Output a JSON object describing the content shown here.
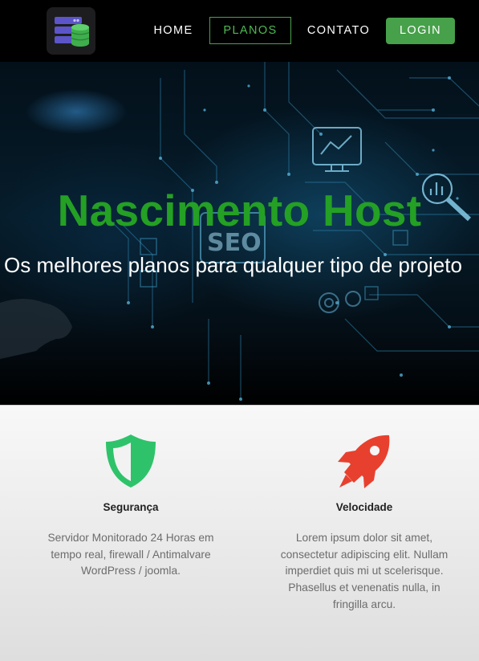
{
  "nav": {
    "logo_icon": "server-database-icon",
    "home": "HOME",
    "planos": "PLANOS",
    "contato": "CONTATO",
    "login": "LOGIN"
  },
  "hero": {
    "title": "Nascimento Host",
    "subtitle": "Os melhores planos para qualquer tipo de projeto",
    "background_labels": [
      "SEO"
    ]
  },
  "features": [
    {
      "icon": "shield-icon",
      "icon_color": "#2ec36a",
      "title": "Segurança",
      "text": "Servidor Monitorado 24 Horas em tempo real, firewall / Antimalvare WordPress / joomla."
    },
    {
      "icon": "rocket-icon",
      "icon_color": "#e8402e",
      "title": "Velocidade",
      "text": "Lorem ipsum dolor sit amet, consectetur adipiscing elit. Nullam imperdiet quis mi ut scelerisque. Phasellus et venenatis nulla, in fringilla arcu."
    }
  ],
  "colors": {
    "accent_green": "#47a04a",
    "title_green": "#24a024",
    "navbar_bg": "#000000"
  }
}
